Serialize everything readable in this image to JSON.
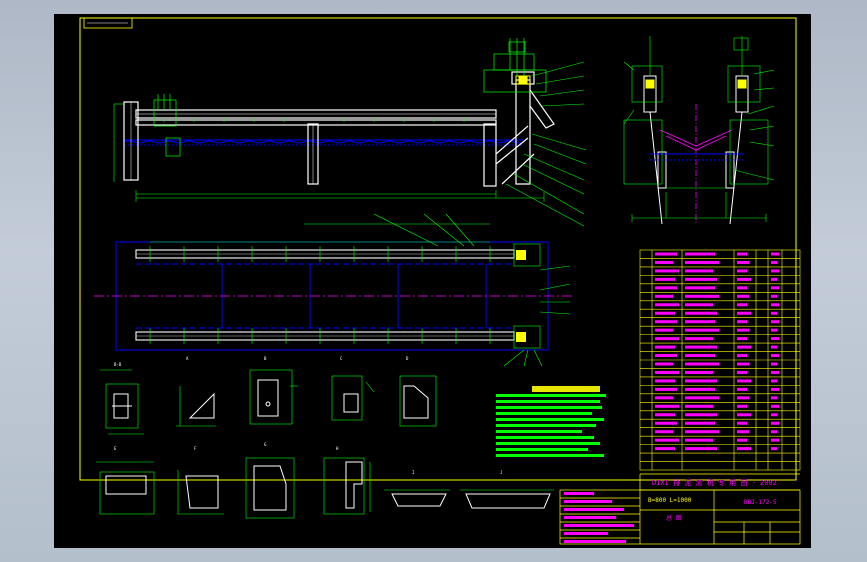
{
  "drawing": {
    "colors": {
      "background": "#000000",
      "border": "#ffff00",
      "steel": "#ffffff",
      "dimension": "#00ff00",
      "water": "#0000ff",
      "centerline": "#ff00ff",
      "annotation": "#ffff00"
    },
    "title_block": {
      "title": "DIXI 排 泥 渣 机 专 用 图 - 2002",
      "drawing_no": "BBJ-172-5",
      "spec": "B=800 L=1000",
      "sheet_label": "总 图"
    }
  }
}
